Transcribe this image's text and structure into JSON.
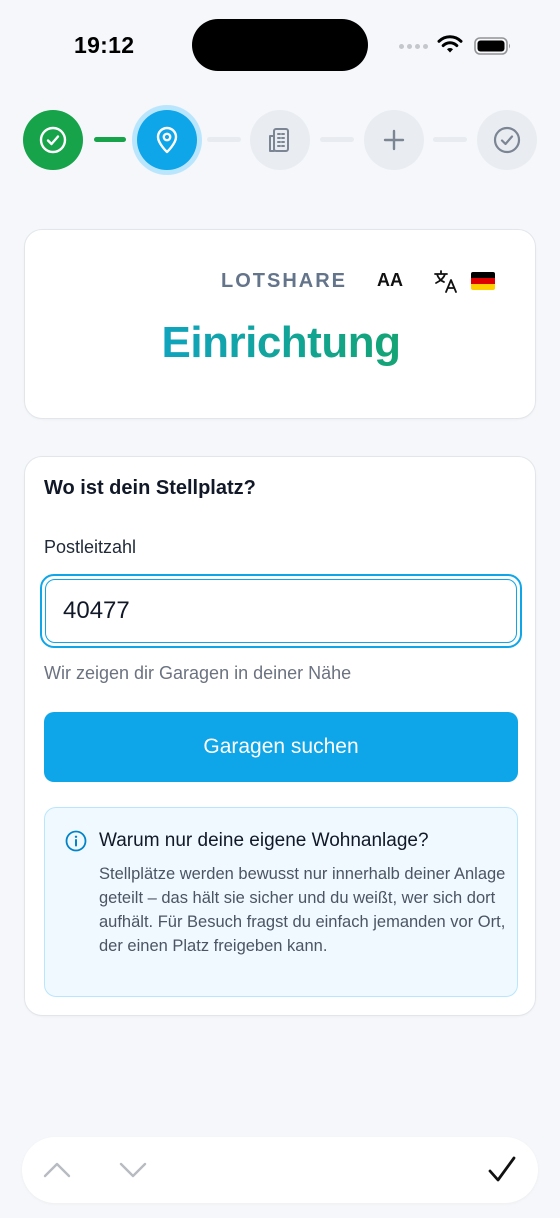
{
  "status_bar": {
    "time": "19:12",
    "icons": [
      "signal-icon",
      "wifi-icon",
      "battery-icon"
    ]
  },
  "stepper": {
    "steps": [
      {
        "icon": "check-circle-icon",
        "state": "done"
      },
      {
        "icon": "map-pin-icon",
        "state": "active"
      },
      {
        "icon": "building-icon",
        "state": "pending"
      },
      {
        "icon": "plus-icon",
        "state": "pending"
      },
      {
        "icon": "check-circle-icon",
        "state": "pending"
      }
    ]
  },
  "header": {
    "brand": "LOTSHARE",
    "font_size_label": "AA",
    "translate_icon": "translate-icon",
    "flag_icon": "german-flag-icon",
    "title": "Einrichtung"
  },
  "form": {
    "question": "Wo ist dein Stellplatz?",
    "postal_code_label": "Postleitzahl",
    "postal_code_value": "40477",
    "hint": "Wir zeigen dir Garagen in deiner Nähe",
    "search_button": "Garagen suchen",
    "info": {
      "icon": "info-icon",
      "title": "Warum nur deine eigene Wohnanlage?",
      "body": "Stellplätze werden bewusst nur innerhalb deiner Anlage geteilt – das hält sie sicher und du weißt, wer sich dort aufhält. Für Besuch fragst du einfach jemanden vor Ort, der einen Platz freigeben kann."
    }
  },
  "keyboard_toolbar": {
    "icons": [
      "chevron-up-icon",
      "chevron-down-icon",
      "checkmark-icon"
    ]
  },
  "colors": {
    "accent": "#0ea5e9",
    "success": "#16a34a",
    "info_bg": "#f0f9ff"
  }
}
